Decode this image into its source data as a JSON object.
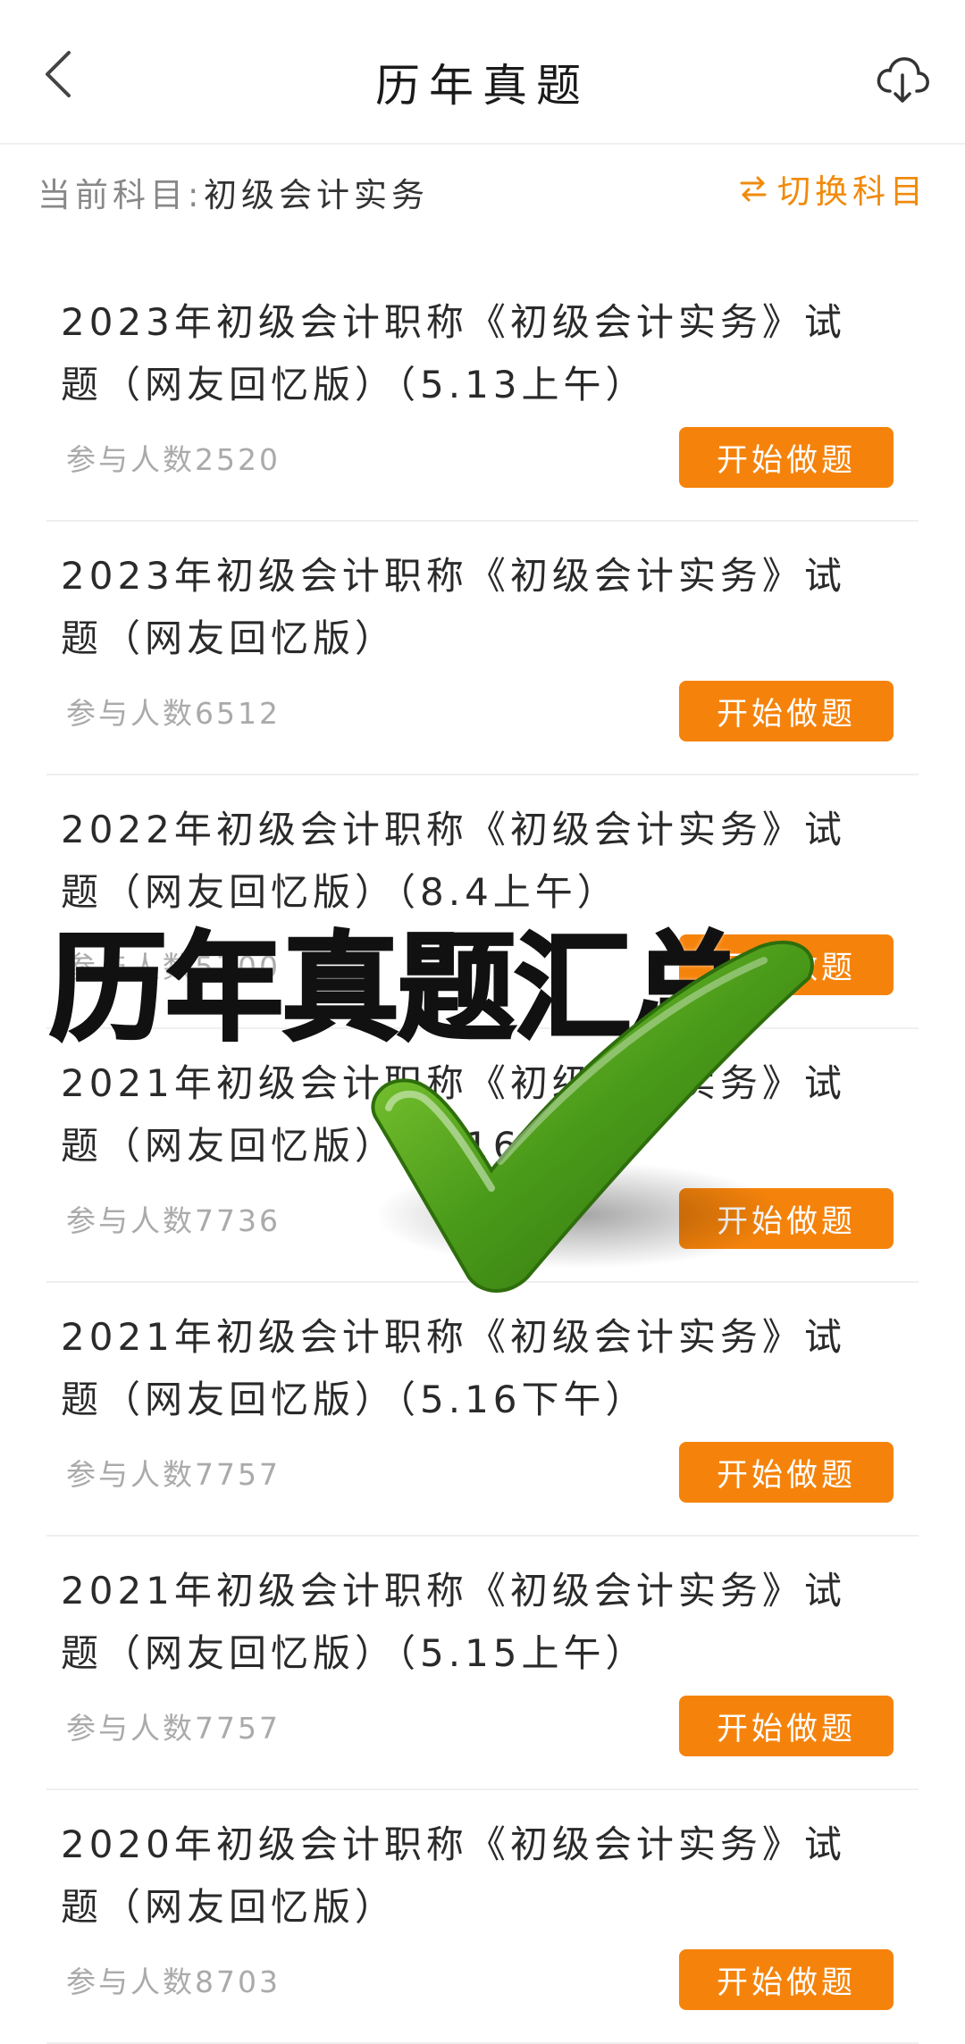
{
  "header": {
    "title": "历年真题",
    "back_icon": "chevron-left-icon",
    "download_icon": "cloud-download-icon"
  },
  "subject": {
    "label": "当前科目:",
    "value": "初级会计实务",
    "switch_label": "切换科目",
    "switch_icon": "swap-arrows-icon"
  },
  "items": [
    {
      "title": "2023年初级会计职称《初级会计实务》试题（网友回忆版）（5.13上午）",
      "count": "参与人数2520",
      "button": "开始做题"
    },
    {
      "title": "2023年初级会计职称《初级会计实务》试题（网友回忆版）",
      "count": "参与人数6512",
      "button": "开始做题"
    },
    {
      "title": "2022年初级会计职称《初级会计实务》试题（网友回忆版）（8.4上午）",
      "count": "参与人数5700",
      "button": "开始做题"
    },
    {
      "title": "2021年初级会计职称《初级会计实务》试题（网友回忆版）（5.16上午）",
      "count": "参与人数7736",
      "button": "开始做题"
    },
    {
      "title": "2021年初级会计职称《初级会计实务》试题（网友回忆版）（5.16下午）",
      "count": "参与人数7757",
      "button": "开始做题"
    },
    {
      "title": "2021年初级会计职称《初级会计实务》试题（网友回忆版）（5.15上午）",
      "count": "参与人数7757",
      "button": "开始做题"
    },
    {
      "title": "2020年初级会计职称《初级会计实务》试题（网友回忆版）",
      "count": "参与人数8703",
      "button": "开始做题"
    }
  ],
  "overlay": {
    "text": "历年真题汇总",
    "check_icon": "green-checkmark-icon",
    "check_color": "#4a9a1a"
  },
  "colors": {
    "accent": "#f5830b",
    "switch_text": "#f08a0b"
  }
}
